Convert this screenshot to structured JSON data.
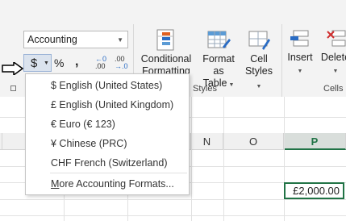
{
  "ribbon": {
    "number_format_value": "Accounting",
    "accounting_symbol": "$",
    "percent_symbol": "%",
    "comma_symbol": ",",
    "increase_decimal_top": "←0",
    "increase_decimal_bottom": ".00",
    "decrease_decimal_top": ".00",
    "decrease_decimal_bottom": "→.0",
    "styles_group_label": "Styles",
    "cells_group_label": "Cells",
    "buttons": {
      "conditional_formatting_line1": "Conditional",
      "conditional_formatting_line2": "Formatting",
      "format_as_table_line1": "Format as",
      "format_as_table_line2": "Table",
      "cell_styles_line1": "Cell",
      "cell_styles_line2": "Styles",
      "insert": "Insert",
      "delete": "Delete"
    }
  },
  "menu": {
    "items": [
      "$ English (United States)",
      "£ English (United Kingdom)",
      "€ Euro (€ 123)",
      "¥ Chinese (PRC)",
      "CHF French (Switzerland)"
    ],
    "more_prefix": "M",
    "more_rest": "ore Accounting Formats..."
  },
  "grid": {
    "columns": [
      "N",
      "O",
      "P"
    ],
    "selected_column": "P",
    "active_cell_value": "£2,000.00"
  },
  "colors": {
    "excel_green": "#217346",
    "accent_blue": "#2a6cc4",
    "ribbon_bg": "#f3f3f3"
  }
}
